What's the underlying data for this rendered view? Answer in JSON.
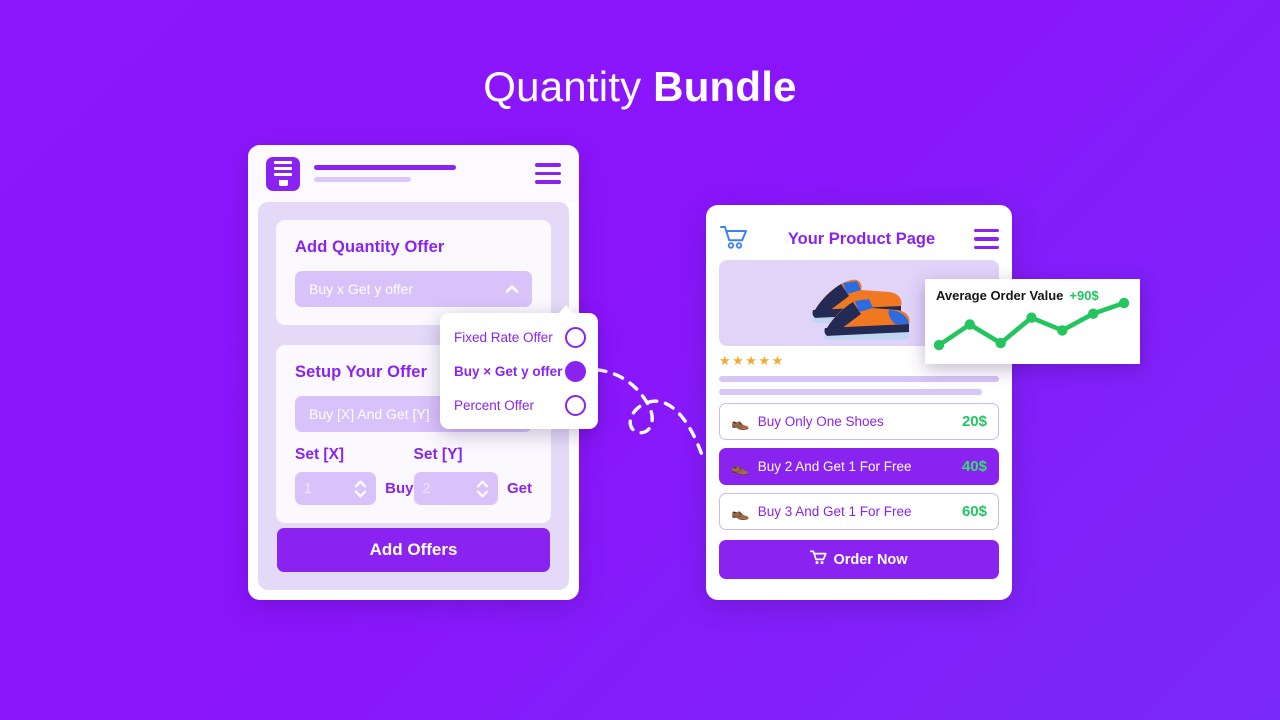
{
  "title": {
    "thin": "Quantity",
    "bold": "Bundle"
  },
  "colors": {
    "background_start": "#8D17FB",
    "background_end": "#7A2AF8",
    "accent_purple": "#8B23F0",
    "field_lavender": "#D9C2FA",
    "panel_lavender": "#E4DAF8",
    "price_green": "#20C665",
    "star_orange": "#FBA92C"
  },
  "admin_panel": {
    "icon": "document-form-icon",
    "menu_icon": "hamburger-menu-icon",
    "add_offer_card": {
      "heading": "Add Quantity Offer",
      "select_value": "Buy x Get y offer",
      "select_chevron": "chevron-up-icon"
    },
    "setup_card": {
      "heading": "Setup Your Offer",
      "select_value": "Buy [X] And Get [Y]",
      "set_x": {
        "label": "Set [X]",
        "value": "1",
        "unit": "Buy"
      },
      "set_y": {
        "label": "Set [Y]",
        "value": "2",
        "unit": "Get"
      }
    },
    "submit_label": "Add Offers"
  },
  "offer_dropdown": {
    "options": [
      {
        "label": "Fixed Rate Offer",
        "selected": false
      },
      {
        "label": "Buy × Get y offer",
        "selected": true
      },
      {
        "label": "Percent Offer",
        "selected": false
      }
    ]
  },
  "store_panel": {
    "cart_icon": "shopping-cart-icon",
    "title": "Your Product Page",
    "menu_icon": "hamburger-menu-icon",
    "product_image": "sneakers-illustration",
    "rating_stars": "★★★★★",
    "offers": [
      {
        "icon": "👞",
        "label": "Buy Only One Shoes",
        "price": "20$",
        "active": false
      },
      {
        "icon": "👞",
        "label": "Buy 2 And Get 1 For Free",
        "price": "40$",
        "active": true
      },
      {
        "icon": "👞",
        "label": "Buy 3 And Get 1 For Free",
        "price": "60$",
        "active": false
      }
    ],
    "order_button": {
      "icon": "shopping-cart-icon",
      "label": "Order Now"
    }
  },
  "aov_card": {
    "label": "Average Order Value",
    "delta": "+90$"
  },
  "chart_data": {
    "type": "line",
    "title": "Average Order Value",
    "annotation": "+90$",
    "x": [
      1,
      2,
      3,
      4,
      5,
      6,
      7
    ],
    "values": [
      10,
      52,
      14,
      66,
      40,
      74,
      96
    ],
    "series": [
      {
        "name": "Average Order Value",
        "values": [
          10,
          52,
          14,
          66,
          40,
          74,
          96
        ],
        "color": "#22C55E"
      }
    ],
    "xlabel": "",
    "ylabel": "",
    "ylim": [
      0,
      100
    ],
    "grid": false,
    "legend": false,
    "markers": true
  },
  "connector": {
    "style": "dashed-curved-arrow",
    "color": "#FFFFFF"
  }
}
